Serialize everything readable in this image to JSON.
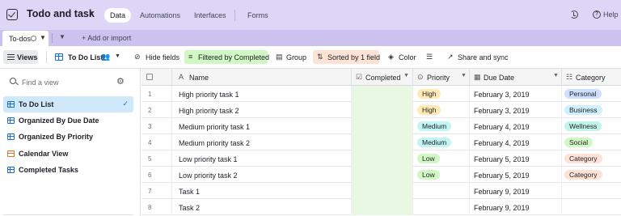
{
  "header": {
    "base_name": "Todo and task",
    "tabs": [
      {
        "label": "Data",
        "active": true
      },
      {
        "label": "Automations",
        "active": false
      },
      {
        "label": "Interfaces",
        "active": false
      },
      {
        "label": "Forms",
        "active": false
      }
    ],
    "help_label": "Help"
  },
  "table_tabs": {
    "active_tab": "To-dos",
    "add_import": "Add or import"
  },
  "toolbar": {
    "views": "Views",
    "current_view": "To Do List",
    "hide_fields": "Hide fields",
    "filter": "Filtered by Completed",
    "group": "Group",
    "sort": "Sorted by 1 field",
    "color": "Color",
    "share": "Share and sync"
  },
  "sidebar": {
    "find_placeholder": "Find a view",
    "views": [
      {
        "label": "To Do List",
        "type": "grid",
        "active": true
      },
      {
        "label": "Organized By Due Date",
        "type": "grid",
        "active": false
      },
      {
        "label": "Organized By Priority",
        "type": "grid",
        "active": false
      },
      {
        "label": "Calendar View",
        "type": "calendar",
        "active": false
      },
      {
        "label": "Completed Tasks",
        "type": "grid",
        "active": false
      }
    ]
  },
  "grid": {
    "columns": [
      "Name",
      "Completed",
      "Priority",
      "Due Date",
      "Category"
    ],
    "rows": [
      {
        "num": "1",
        "name": "High priority task 1",
        "priority": "High",
        "due": "February 3, 2019",
        "category": "Personal"
      },
      {
        "num": "2",
        "name": "High priority task 2",
        "priority": "High",
        "due": "February 3, 2019",
        "category": "Business"
      },
      {
        "num": "3",
        "name": "Medium priority task 1",
        "priority": "Medium",
        "due": "February 4, 2019",
        "category": "Wellness"
      },
      {
        "num": "4",
        "name": "Medium priority task 2",
        "priority": "Medium",
        "due": "February 4, 2019",
        "category": "Social"
      },
      {
        "num": "5",
        "name": "Low priority task 1",
        "priority": "Low",
        "due": "February 5, 2019",
        "category": "Category"
      },
      {
        "num": "6",
        "name": "Low priority task 2",
        "priority": "Low",
        "due": "February 5, 2019",
        "category": "Category"
      },
      {
        "num": "7",
        "name": "Task 1",
        "priority": "",
        "due": "February 9, 2019",
        "category": ""
      },
      {
        "num": "8",
        "name": "Task 2",
        "priority": "",
        "due": "February 9, 2019",
        "category": ""
      }
    ]
  },
  "colors": {
    "header_bg": "#ddd6f6",
    "tabbar_bg": "#cbc2ef",
    "filter_bg": "#d1f7c4",
    "sort_bg": "#fee2d5",
    "selected_view_bg": "#cfe9fb"
  }
}
